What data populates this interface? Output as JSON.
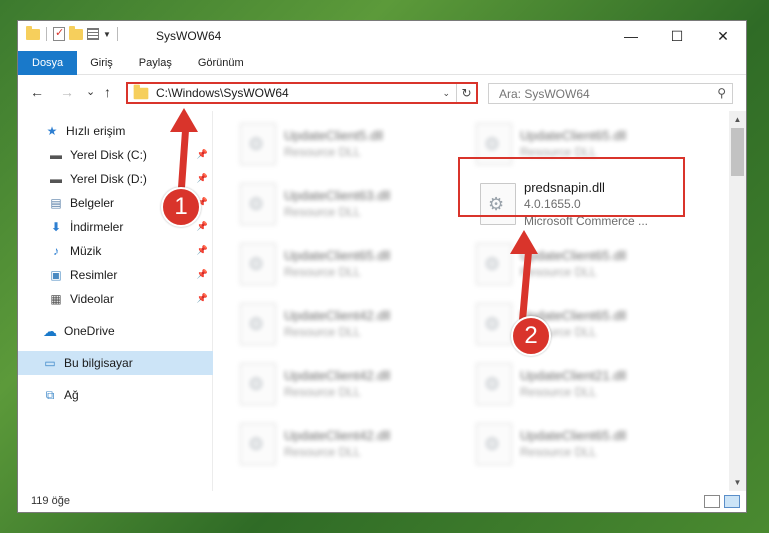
{
  "window": {
    "title": "SysWOW64",
    "controls": {
      "minimize": "—",
      "maximize": "☐",
      "close": "✕"
    }
  },
  "ribbon": {
    "tabs": [
      "Dosya",
      "Giriş",
      "Paylaş",
      "Görünüm"
    ]
  },
  "nav": {
    "back": "←",
    "forward": "→",
    "recent": "⌄",
    "up": "↑",
    "address": "C:\\Windows\\SysWOW64",
    "search_placeholder": "Ara: SysWOW64",
    "refresh": "↻",
    "dropdown": "⌄"
  },
  "sidebar": {
    "items": [
      {
        "label": "Hızlı erişim",
        "icon": "star-icon"
      },
      {
        "label": "Yerel Disk (C:)",
        "icon": "drive-icon"
      },
      {
        "label": "Yerel Disk (D:)",
        "icon": "drive-icon"
      },
      {
        "label": "Belgeler",
        "icon": "documents-icon"
      },
      {
        "label": "İndirmeler",
        "icon": "download-icon"
      },
      {
        "label": "Müzik",
        "icon": "music-icon"
      },
      {
        "label": "Resimler",
        "icon": "pictures-icon"
      },
      {
        "label": "Videolar",
        "icon": "videos-icon"
      },
      {
        "label": "OneDrive",
        "icon": "cloud-icon"
      },
      {
        "label": "Bu bilgisayar",
        "icon": "computer-icon"
      },
      {
        "label": "Ağ",
        "icon": "network-icon"
      }
    ]
  },
  "files": {
    "left": [
      {
        "name": "UpdateClient5.dll",
        "sub": "Resource DLL"
      },
      {
        "name": "UpdateClient63.dll",
        "sub": "Resource DLL"
      },
      {
        "name": "UpdateClient65.dll",
        "sub": "Resource DLL"
      },
      {
        "name": "UpdateClient42.dll",
        "sub": "Resource DLL"
      },
      {
        "name": "UpdateClient42.dll",
        "sub": "Resource DLL"
      },
      {
        "name": "UpdateClient42.dll",
        "sub": "Resource DLL"
      }
    ],
    "right": [
      {
        "name": "UpdateClient65.dll",
        "sub": "Resource DLL"
      },
      {
        "name": "UpdateClient65.dll",
        "sub": "Resource DLL"
      },
      {
        "name": "UpdateClient65.dll",
        "sub": "Resource DLL"
      },
      {
        "name": "UpdateClient21.dll",
        "sub": "Resource DLL"
      },
      {
        "name": "UpdateClient65.dll",
        "sub": "Resource DLL"
      }
    ],
    "highlighted": {
      "name": "predsnapin.dll",
      "version": "4.0.1655.0",
      "description": "Microsoft Commerce ..."
    }
  },
  "status": {
    "count": "119 öğe"
  },
  "callouts": {
    "step1": "1",
    "step2": "2"
  },
  "colors": {
    "accent": "#1979ca",
    "highlight": "#d9342b",
    "selected": "#cce4f7"
  }
}
